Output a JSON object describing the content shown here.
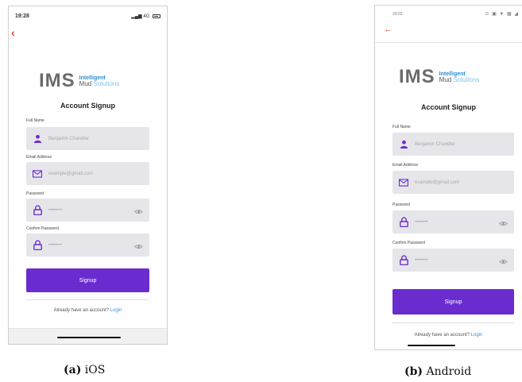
{
  "ios": {
    "status_time": "19:28",
    "status_right": "4G",
    "logo_mark": "IMS",
    "logo_line1": "Intelligent",
    "logo_line2_a": "Mud",
    "logo_line2_b": "Solutions",
    "title": "Account Signup",
    "fullname_label": "Full Name",
    "fullname_placeholder": "Benjamin Chandler",
    "email_label": "Email Address",
    "email_placeholder": "example@gmail.com",
    "password_label": "Password",
    "password_placeholder": "••••••••",
    "confirm_label": "Confirm Password",
    "confirm_placeholder": "••••••••",
    "signup_label": "Signup",
    "login_prompt": "Already have an account?",
    "login_link": "Login"
  },
  "android": {
    "status_time": "20:02",
    "status_right": "⊙ ▣ ▼ ▦ ◢",
    "logo_mark": "IMS",
    "logo_line1": "Intelligent",
    "logo_line2_a": "Mud",
    "logo_line2_b": "Solutions",
    "title": "Account Signup",
    "fullname_label": "Full Name",
    "fullname_placeholder": "Benjamin Chandler",
    "email_label": "Email Address",
    "email_placeholder": "example@gmail.com",
    "password_label": "Password",
    "password_placeholder": "••••••••",
    "confirm_label": "Confirm Password",
    "confirm_placeholder": "••••••••",
    "signup_label": "Signup",
    "login_prompt": "Already have an account?",
    "login_link": "Login"
  },
  "captions": {
    "ios_tag": "(a)",
    "ios_text": "iOS",
    "android_tag": "(b)",
    "android_text": "Android"
  },
  "colors": {
    "primary": "#6a2ccf",
    "back_arrow": "#e53935",
    "field_bg": "#e6e6ea",
    "link": "#3d8fe0"
  },
  "icons": [
    "back-arrow-icon",
    "user-icon",
    "mail-icon",
    "lock-icon",
    "eye-icon"
  ]
}
